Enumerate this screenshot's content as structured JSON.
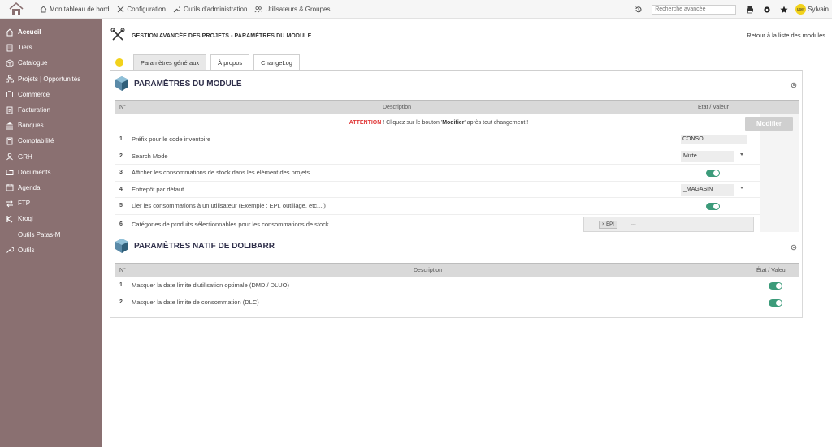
{
  "topbar": {
    "nav": [
      {
        "label": "Mon tableau de bord",
        "icon": "home-icon"
      },
      {
        "label": "Configuration",
        "icon": "tools-icon"
      },
      {
        "label": "Outils d'administration",
        "icon": "wrench-icon"
      },
      {
        "label": "Utilisateurs & Groupes",
        "icon": "users-icon"
      }
    ],
    "search_placeholder": "Recherche avancée",
    "user_name": "Sylvain",
    "avatar_text": "user"
  },
  "sidebar": {
    "items": [
      {
        "label": "Accueil",
        "icon": "home-icon",
        "active": true
      },
      {
        "label": "Tiers",
        "icon": "building-icon"
      },
      {
        "label": "Catalogue",
        "icon": "box-icon"
      },
      {
        "label": "Projets | Opportunités",
        "icon": "sitemap-icon"
      },
      {
        "label": "Commerce",
        "icon": "cart-icon"
      },
      {
        "label": "Facturation",
        "icon": "invoice-icon"
      },
      {
        "label": "Banques",
        "icon": "bank-icon"
      },
      {
        "label": "Comptabilité",
        "icon": "calculator-icon"
      },
      {
        "label": "GRH",
        "icon": "people-icon"
      },
      {
        "label": "Documents",
        "icon": "folder-icon"
      },
      {
        "label": "Agenda",
        "icon": "calendar-icon"
      },
      {
        "label": "FTP",
        "icon": "transfer-icon"
      },
      {
        "label": "Kroqi",
        "icon": "kroqi-icon"
      },
      {
        "label": "Outils Patas-M",
        "icon": "",
        "sub": true
      },
      {
        "label": "Outils",
        "icon": "wrench-icon"
      }
    ]
  },
  "page": {
    "title": "GESTION AVANCÉE DES PROJETS - PARAMÈTRES DU MODULE",
    "back_link": "Retour à la liste des modules"
  },
  "tabs": [
    {
      "label": "Paramètres généraux",
      "active": true
    },
    {
      "label": "À propos",
      "active": false
    },
    {
      "label": "ChangeLog",
      "active": false
    }
  ],
  "section1": {
    "title": "PARAMÈTRES DU MODULE",
    "headers": {
      "num": "N°",
      "description": "Description",
      "value": "État / Valeur"
    },
    "attention": {
      "prefix": "ATTENTION",
      "text1": " ! Cliquez sur le bouton '",
      "bold": "Modifier",
      "text2": "' après tout changement !"
    },
    "modify_button": "Modifier",
    "rows": [
      {
        "num": "1",
        "label": "Préfix pour le code inventoire",
        "value": "CONSO"
      },
      {
        "num": "2",
        "label": "Search Mode",
        "value": "Mixte"
      },
      {
        "num": "3",
        "label": "Afficher les consommations de stock dans les élément des projets",
        "toggle": true
      },
      {
        "num": "4",
        "label": "Entrepôt par défaut",
        "value": "_MAGASIN"
      },
      {
        "num": "5",
        "label": "Lier les consommations à un utilisateur (Exemple : EPI, outillage, etc....)",
        "toggle": true
      },
      {
        "num": "6",
        "label": "Catégories de produits sélectionnables pour les consommations de stock",
        "chip": "× EPI",
        "more": "..."
      }
    ]
  },
  "section2": {
    "title": "PARAMÈTRES NATIF DE DOLIBARR",
    "headers": {
      "num": "N°",
      "description": "Description",
      "value": "État / Valeur"
    },
    "rows": [
      {
        "num": "1",
        "label": "Masquer la date limite d'utilisation optimale (DMD / DLUO)",
        "toggle": true
      },
      {
        "num": "2",
        "label": "Masquer la date limite de consommation (DLC)",
        "toggle": true
      }
    ]
  },
  "colors": {
    "sidebar_bg": "#8a7071",
    "toggle_on": "#3c9b7a",
    "attention_red": "#e03737",
    "title_color": "#2f2f4a"
  }
}
